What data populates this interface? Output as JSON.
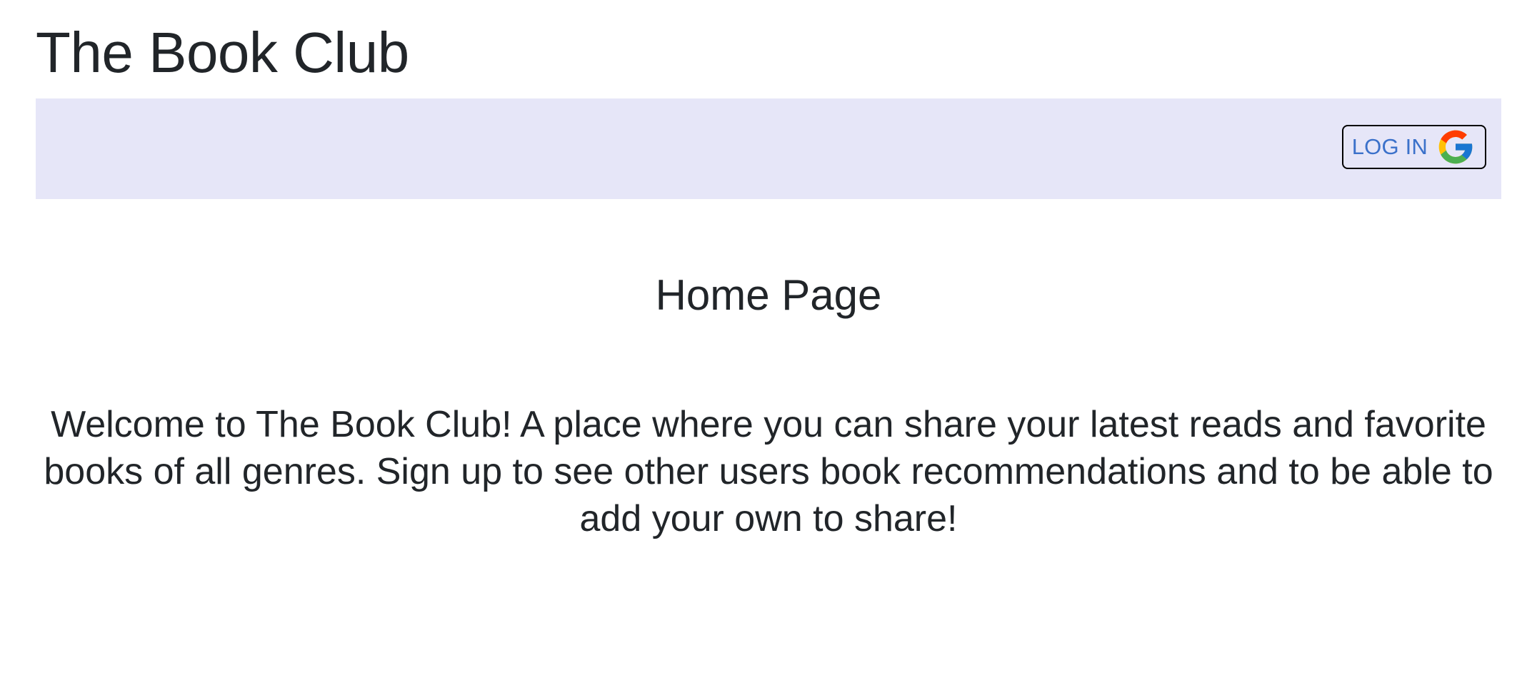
{
  "header": {
    "site_title": "The Book Club"
  },
  "navbar": {
    "background_color": "#e6e6f8",
    "login_button": {
      "label": "LOG IN",
      "icon": "google-icon",
      "label_color": "#3b71ca"
    }
  },
  "main": {
    "heading": "Home Page",
    "welcome_text": "Welcome to The Book Club! A place where you can share your latest reads and favorite books of all genres. Sign up to see other users book recommendations and to be able to add your own to share!"
  }
}
